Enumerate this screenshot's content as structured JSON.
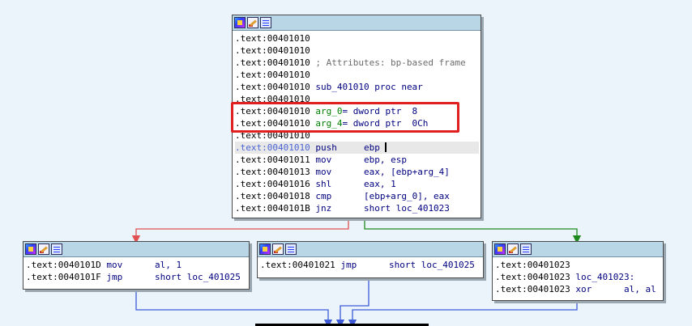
{
  "colors": {
    "background": "#eaf4fa",
    "edge_false": "#e05050",
    "edge_true": "#1e8a1e",
    "edge_flow": "#3f5bd8",
    "highlight": "#e02020"
  },
  "header_icons": [
    "graph-overview-icon",
    "edit-icon",
    "text-listing-icon"
  ],
  "main_block": {
    "lines": [
      {
        "addr": ".text:00401010",
        "mnem": "",
        "ops": "",
        "comment": ""
      },
      {
        "addr": ".text:00401010",
        "mnem": "",
        "ops": "",
        "comment": ""
      },
      {
        "addr": ".text:00401010",
        "mnem": "",
        "ops": "",
        "comment": "; Attributes: bp-based frame"
      },
      {
        "addr": ".text:00401010",
        "mnem": "",
        "ops": "",
        "comment": ""
      },
      {
        "addr": ".text:00401010",
        "mnem": "sub_401010",
        "ops": "proc near",
        "comment": ""
      },
      {
        "addr": ".text:00401010",
        "mnem": "",
        "ops": "",
        "comment": ""
      },
      {
        "addr": ".text:00401010",
        "mnem": "arg_0",
        "ops": "= dword ptr  8",
        "comment": ""
      },
      {
        "addr": ".text:00401010",
        "mnem": "arg_4",
        "ops": "= dword ptr  0Ch",
        "comment": ""
      },
      {
        "addr": ".text:00401010",
        "mnem": "",
        "ops": "",
        "comment": ""
      },
      {
        "addr": ".text:00401010",
        "mnem": "push",
        "ops": "ebp",
        "comment": ""
      },
      {
        "addr": ".text:00401011",
        "mnem": "mov",
        "ops": "ebp, esp",
        "comment": ""
      },
      {
        "addr": ".text:00401013",
        "mnem": "mov",
        "ops": "eax, [ebp+arg_4]",
        "comment": ""
      },
      {
        "addr": ".text:00401016",
        "mnem": "shl",
        "ops": "eax, 1",
        "comment": ""
      },
      {
        "addr": ".text:00401018",
        "mnem": "cmp",
        "ops": "[ebp+arg_0], eax",
        "comment": ""
      },
      {
        "addr": ".text:0040101B",
        "mnem": "jnz",
        "ops": "short loc_401023",
        "comment": ""
      }
    ]
  },
  "block_left": {
    "lines": [
      {
        "addr": ".text:0040101D",
        "mnem": "mov",
        "ops": "al, 1"
      },
      {
        "addr": ".text:0040101F",
        "mnem": "jmp",
        "ops": "short loc_401025"
      }
    ]
  },
  "block_mid": {
    "lines": [
      {
        "addr": ".text:00401021",
        "mnem": "jmp",
        "ops": "short loc_401025"
      }
    ]
  },
  "block_right": {
    "lines": [
      {
        "addr": ".text:00401023",
        "mnem": "",
        "ops": ""
      },
      {
        "addr": ".text:00401023",
        "mnem": "loc_401023:",
        "ops": ""
      },
      {
        "addr": ".text:00401023",
        "mnem": "xor",
        "ops": "al, al"
      }
    ]
  }
}
